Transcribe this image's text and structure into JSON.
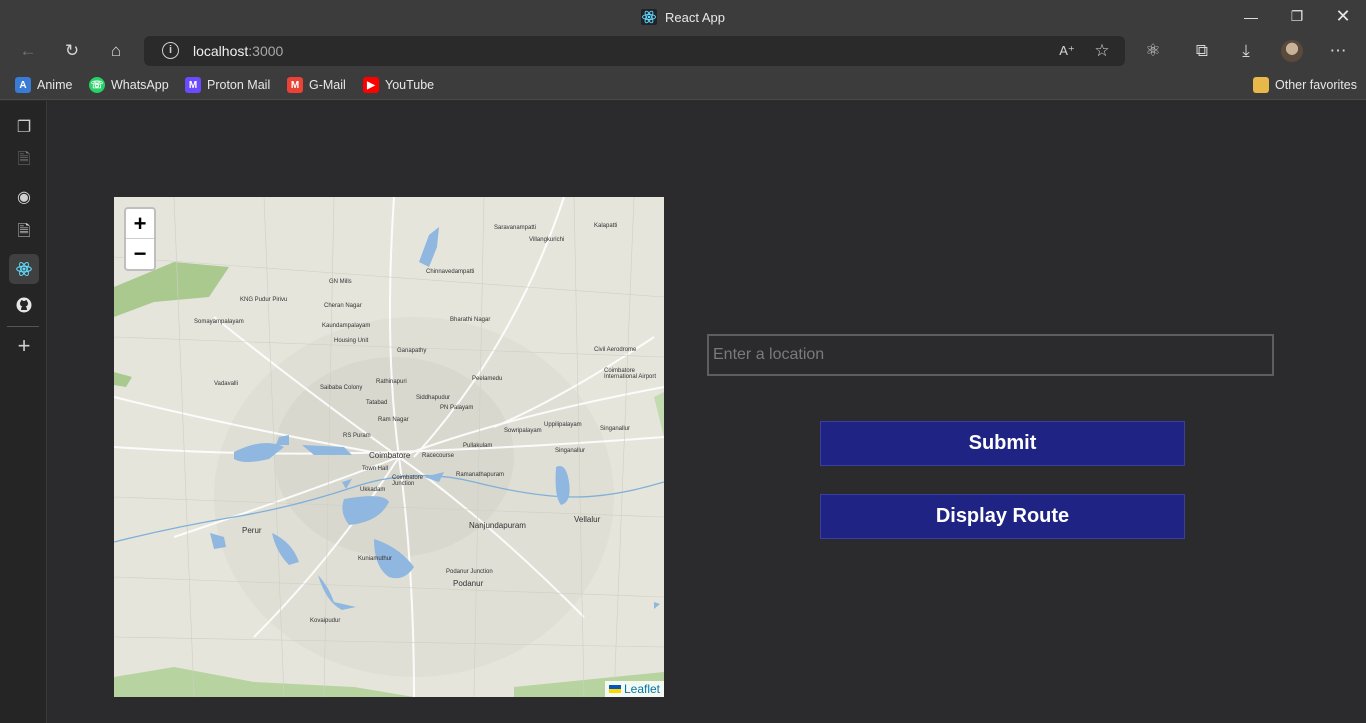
{
  "window": {
    "title": "React App"
  },
  "address_bar": {
    "host": "localhost",
    "port": ":3000"
  },
  "bookmarks": [
    {
      "label": "Anime",
      "icon": "anime-icon",
      "color": "#3a7bd5"
    },
    {
      "label": "WhatsApp",
      "icon": "whatsapp-icon",
      "color": "#25d366"
    },
    {
      "label": "Proton Mail",
      "icon": "proton-mail-icon",
      "color": "#6d4aff"
    },
    {
      "label": "G-Mail",
      "icon": "gmail-icon",
      "color": "#ea4335"
    },
    {
      "label": "YouTube",
      "icon": "youtube-icon",
      "color": "#ff0000"
    }
  ],
  "other_favorites": "Other favorites",
  "map": {
    "zoom_in": "+",
    "zoom_out": "−",
    "attribution": "Leaflet",
    "labels": {
      "kalapatti": "Kalapatti",
      "saravanampatti": "Saravanampatti",
      "villangkurichi": "Villangkurichi",
      "chinnavedampatti": "Chinnavedampatti",
      "gn_mills": "GN Mills",
      "kng_pudur": "KNG Pudur Pirivu",
      "cheran_nagar": "Cheran Nagar",
      "somayampalayam": "Somayampalayam",
      "kaundampalayam": "Kaundampalayam",
      "bharathi_nagar": "Bharathi Nagar",
      "housing_unit": "Housing Unit",
      "ganapathy": "Ganapathy",
      "civil_aerodrome": "Civil Aerodrome",
      "vadavalli": "Vadavalli",
      "rathinapuri": "Rathinapuri",
      "peelamedu": "Peelamedu",
      "coimbatore_airport": "Coimbatore International Airport",
      "saibaba_colony": "Saibaba Colony",
      "tatabad": "Tatabad",
      "siddhapudur": "Siddhapudur",
      "pn_palayam": "PN Palayam",
      "ram_nagar": "Ram Nagar",
      "sowripalayam": "Sowripalayam",
      "uppilipalayam": "Uppilipalayam",
      "singanallur_1": "Singanallur",
      "rs_puram": "RS Puram",
      "pullakulam": "Pullakulam",
      "singanallur_2": "Singanallur",
      "coimbatore": "Coimbatore",
      "racecourse": "Racecourse",
      "town_hall": "Town Hall",
      "ramanathapuram": "Ramanathapuram",
      "coimbatore_junction": "Coimbatore Junction",
      "ukkadam": "Ukkadam",
      "nanjundapuram": "Nanjundapuram",
      "vellalur": "Vellalur",
      "perur": "Perur",
      "kuniamuthur": "Kuniamuthur",
      "podanur_junction": "Podanur Junction",
      "podanur": "Podanur",
      "kovaipudur": "Kovaipudur"
    }
  },
  "form": {
    "location_placeholder": "Enter a location",
    "location_value": "",
    "submit_label": "Submit",
    "route_label": "Display Route"
  }
}
